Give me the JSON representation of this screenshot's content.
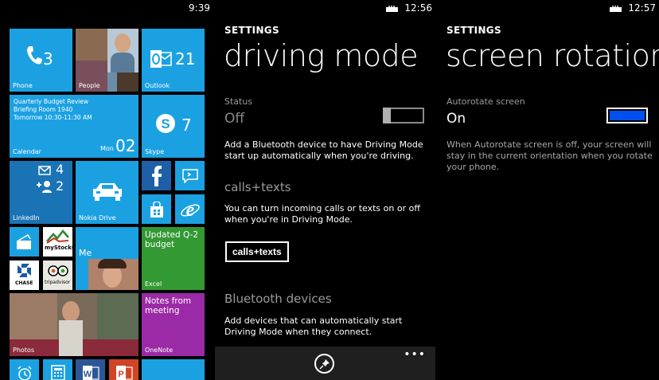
{
  "start": {
    "time": "9:39",
    "tiles": {
      "phone": {
        "label": "Phone",
        "count": "3"
      },
      "people": {
        "label": "People"
      },
      "outlook": {
        "label": "Outlook",
        "count": "21"
      },
      "calendar": {
        "label": "Calendar",
        "line1": "Quarterly Budget Review",
        "line2": "Briefing Room 1940",
        "line3": "Tomorrow 10:30-11:30 AM",
        "day": "Mon",
        "date": "02"
      },
      "skype": {
        "label": "Skype",
        "count": "7"
      },
      "linkedin": {
        "label": "LinkedIn",
        "mail_count": "4",
        "people_count": "2"
      },
      "nokia_drive": {
        "label": "Nokia Drive"
      },
      "excel": {
        "label": "Excel",
        "text": "Updated Q-2 budget"
      },
      "me": {
        "label": "Me"
      },
      "mystocks": {
        "label": "myStocks"
      },
      "chase": {
        "label": "CHASE"
      },
      "tripadvisor": {
        "label": "tripadvisor"
      },
      "photos": {
        "label": "Photos"
      },
      "onenote": {
        "label": "OneNote",
        "text": "Notes from meeting"
      }
    }
  },
  "driving_mode": {
    "time": "12:56",
    "crumb": "SETTINGS",
    "title": "driving mode",
    "status_label": "Status",
    "status_value": "Off",
    "description": "Add a Bluetooth device to have Driving Mode start up automatically when you're driving.",
    "calls_section": "calls+texts",
    "calls_description": "You can turn incoming calls or texts on or off when you're in Driving Mode.",
    "calls_button": "calls+texts",
    "bluetooth_section": "Bluetooth devices",
    "bluetooth_description": "Add devices that can automatically start Driving Mode when they connect.",
    "more": "•••"
  },
  "screen_rotation": {
    "time": "12:57",
    "crumb": "SETTINGS",
    "title": "screen rotation",
    "autorotate_label": "Autorotate screen",
    "autorotate_value": "On",
    "description": "When Autorotate screen is off, your screen will stay in the current orientation when you rotate your phone."
  },
  "colors": {
    "tile_blue": "#1ba1e2",
    "excel_green": "#339933",
    "onenote_purple": "#9b2aa6",
    "toggle_on": "#0050ef"
  }
}
